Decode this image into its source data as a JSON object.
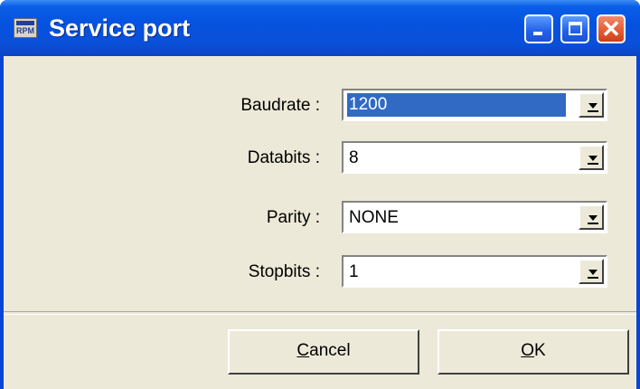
{
  "window": {
    "title": "Service port",
    "app_icon_text": "RPM"
  },
  "form": {
    "fields": [
      {
        "label": "Baudrate :",
        "value": "1200",
        "selected": true
      },
      {
        "label": "Databits :",
        "value": "8",
        "selected": false
      },
      {
        "label": "Parity :",
        "value": "NONE",
        "selected": false
      },
      {
        "label": "Stopbits :",
        "value": "1",
        "selected": false
      }
    ]
  },
  "buttons": {
    "cancel_mnemonic": "C",
    "cancel_rest": "ancel",
    "ok_mnemonic": "O",
    "ok_rest": "K"
  },
  "colors": {
    "titlebar": "#0553e0",
    "client_bg": "#ece9d8",
    "selection": "#316ac5",
    "close_button": "#e35a30"
  }
}
